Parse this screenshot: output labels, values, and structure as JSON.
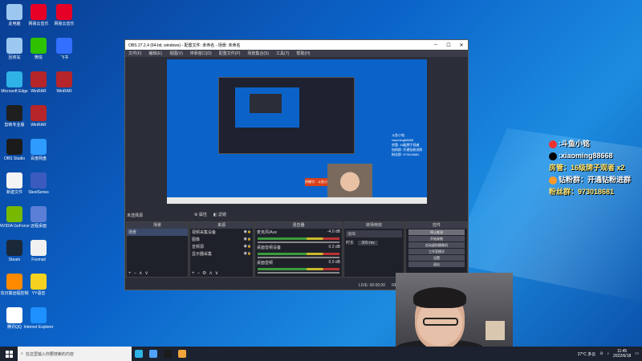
{
  "colors": {
    "desktop_bg": "#0b63c9",
    "obs_bg": "#2b2e38",
    "taskbar_bg": "#1c2230",
    "overlay_accent": "#ffe36b"
  },
  "desktop": {
    "col1": [
      {
        "label": "此电脑",
        "color": "#9cc7ee",
        "icon": "computer-icon"
      },
      {
        "label": "回收站",
        "color": "#9cc7ee",
        "icon": "recycle-bin-icon"
      },
      {
        "label": "Microsoft Edge",
        "color": "#2fb3e6",
        "icon": "edge-icon"
      },
      {
        "label": "剪映专业版",
        "color": "#1f1f1f",
        "icon": "capcut-icon"
      },
      {
        "label": "OBS Studio",
        "color": "#1b1b1b",
        "icon": "obs-icon"
      },
      {
        "label": "新建文件",
        "color": "#f4f4f4",
        "icon": "file-icon"
      },
      {
        "label": "NVIDIA GeForce",
        "color": "#76b900",
        "icon": "nvidia-icon"
      },
      {
        "label": "Steam",
        "color": "#1b2838",
        "icon": "steam-icon"
      },
      {
        "label": "向日葵远程控制",
        "color": "#ff8a00",
        "icon": "sunflower-icon"
      },
      {
        "label": "腾讯QQ",
        "color": "#ffffff",
        "icon": "qq-icon"
      }
    ],
    "col2": [
      {
        "label": "网易云音乐",
        "color": "#e60026",
        "icon": "netease-music-icon"
      },
      {
        "label": "微信",
        "color": "#2dc100",
        "icon": "wechat-icon"
      },
      {
        "label": "WinRAR",
        "color": "#b6252a",
        "icon": "winrar-icon"
      },
      {
        "label": "WinRAR",
        "color": "#b6252a",
        "icon": "winrar-icon"
      },
      {
        "label": "百度网盘",
        "color": "#2e9bff",
        "icon": "baidu-cloud-icon"
      },
      {
        "label": "SteelSeries",
        "color": "#3b5bbf",
        "icon": "steelseries-icon"
      },
      {
        "label": "远程桌面",
        "color": "#5b7fd6",
        "icon": "remote-desktop-icon"
      },
      {
        "label": "Foxmail",
        "color": "#f0f0f0",
        "icon": "foxmail-icon"
      },
      {
        "label": "YY语音",
        "color": "#f5d21f",
        "icon": "yy-icon"
      },
      {
        "label": "Internet Explorer",
        "color": "#1e90ff",
        "icon": "ie-icon"
      }
    ],
    "col3": [
      {
        "label": "网易云音乐",
        "color": "#e60026",
        "icon": "netease-music-icon"
      },
      {
        "label": "飞书",
        "color": "#3370ff",
        "icon": "feishu-icon"
      },
      {
        "label": "WinRAR",
        "color": "#b6252a",
        "icon": "winrar-icon"
      }
    ]
  },
  "obs": {
    "title": "OBS 27.2.4 (64-bit, windows) - 配置文件: 未命名 - 场景: 未命名",
    "menu": [
      "文件(F)",
      "编辑(E)",
      "视图(V)",
      "停靠窗口(D)",
      "配置文件(P)",
      "场景集合(S)",
      "工具(T)",
      "帮助(H)"
    ],
    "preview_overlay_text": [
      "斗鱼小铭",
      "xiaoming88668",
      "房管: 16级牌子观者",
      "钻粉群: 开通钻粉进群",
      "粉丝群: 973018681"
    ],
    "preview_red_label": "拼播号：斗鱼小铭",
    "no_source_label": "未选择源",
    "filter_label": "属性",
    "filter_label2": "滤镜",
    "scenes_header": "场景",
    "scene_item": "场景",
    "sources_header": "来源",
    "sources": [
      "视频采集设备",
      "图像",
      "音频源",
      "显示器采集"
    ],
    "mixer_header": "混音器",
    "mixer_items": [
      "麦克风/Aux",
      "桌面音频设备",
      "桌面音频"
    ],
    "mixer_levels": [
      "-4.0 dB",
      "0.0 dB",
      "0.0 dB"
    ],
    "transitions_header": "转场特效",
    "transition_value": "淡出",
    "duration_label": "时长",
    "duration_value": "300 ms",
    "controls_header": "控件",
    "controls": [
      "停止推流",
      "开始录制",
      "启动虚拟摄像机",
      "工作室模式",
      "设置",
      "退出"
    ],
    "status": [
      "LIVE: 00:00:00",
      "REC: 00:00:00",
      "CPU: 0.3%, 30.00 fps"
    ]
  },
  "overlay": {
    "douyu": ":斗鱼小铭",
    "tiktok": ":xiaoming88668",
    "admin": "房管：16级牌子观者",
    "admin_suffix": "x2",
    "diamond": "钻粉群：开通钻粉进群",
    "fans": "粉丝群：973018681"
  },
  "taskbar": {
    "search_placeholder": "在这里输入你要搜索的内容",
    "apps": [
      {
        "name": "edge-taskbar",
        "color": "#2fb3e6"
      },
      {
        "name": "check-taskbar",
        "color": "#4fa3ff"
      },
      {
        "name": "obs-taskbar",
        "color": "#1b1b1b"
      },
      {
        "name": "folder-taskbar",
        "color": "#f2a43b"
      }
    ],
    "weather": "27°C 多云",
    "time": "11:45",
    "date": "2022/6/18"
  }
}
